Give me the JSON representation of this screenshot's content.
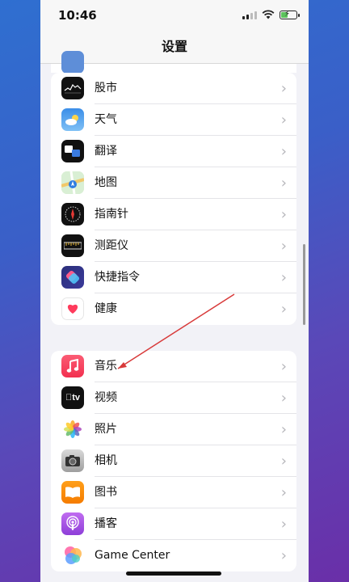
{
  "status": {
    "time": "10:46"
  },
  "nav": {
    "title": "设置"
  },
  "group1": [
    {
      "label": "股市",
      "icon": "stocks-icon"
    },
    {
      "label": "天气",
      "icon": "weather-icon"
    },
    {
      "label": "翻译",
      "icon": "translate-icon"
    },
    {
      "label": "地图",
      "icon": "maps-icon"
    },
    {
      "label": "指南针",
      "icon": "compass-icon"
    },
    {
      "label": "测距仪",
      "icon": "measure-icon"
    },
    {
      "label": "快捷指令",
      "icon": "shortcuts-icon"
    },
    {
      "label": "健康",
      "icon": "health-icon"
    }
  ],
  "group2": [
    {
      "label": "音乐",
      "icon": "music-icon"
    },
    {
      "label": "视频",
      "icon": "tv-icon"
    },
    {
      "label": "照片",
      "icon": "photos-icon"
    },
    {
      "label": "相机",
      "icon": "camera-icon"
    },
    {
      "label": "图书",
      "icon": "books-icon"
    },
    {
      "label": "播客",
      "icon": "podcasts-icon"
    },
    {
      "label": "Game Center",
      "icon": "game-center-icon"
    }
  ],
  "icon_glyphs": {
    "tv": "tv"
  },
  "chevron": "›"
}
